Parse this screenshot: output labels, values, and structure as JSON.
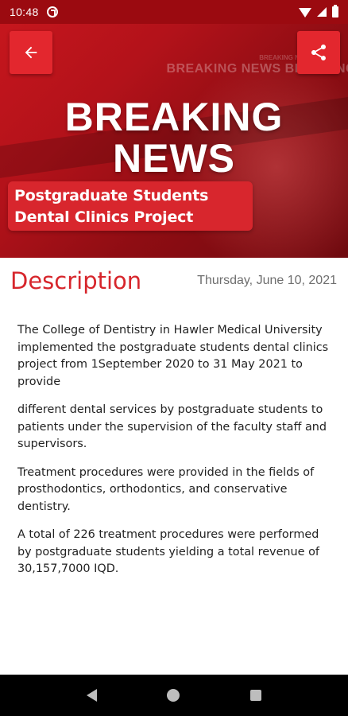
{
  "status_bar": {
    "time": "10:48"
  },
  "banner": {
    "title_line1": "BREAKING",
    "title_line2": "NEWS",
    "ticker": "BREAKING NEWS  BREAKING",
    "ticker_small": "BREAKING NEWS  BREAKI",
    "caption_line1": "Postgraduate Students",
    "caption_line2": "Dental Clinics Project"
  },
  "toolbar": {
    "back_icon": "arrow-back-icon",
    "share_icon": "share-icon"
  },
  "article": {
    "heading": "Description",
    "date": "Thursday, June 10, 2021",
    "paragraphs": [
      "The College of Dentistry in Hawler Medical University implemented the postgraduate students dental clinics project from 1September 2020 to 31 May 2021 to provide",
      "different dental services by postgraduate students to patients under the supervision of the faculty staff and supervisors.",
      "Treatment procedures were provided in the fields of prosthodontics, orthodontics, and conservative dentistry.",
      "A total of 226 treatment procedures were performed by postgraduate students yielding a total revenue of 30,157,7000 IQD."
    ]
  },
  "colors": {
    "accent": "#d7262c",
    "banner": "#b3121a",
    "status_bar": "#9b0a10"
  }
}
